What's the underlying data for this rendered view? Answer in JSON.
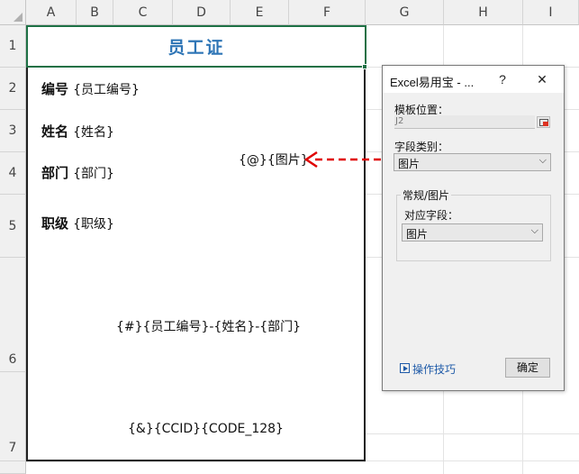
{
  "columns": [
    "A",
    "B",
    "C",
    "D",
    "E",
    "F",
    "G",
    "H",
    "I"
  ],
  "rows": [
    "1",
    "2",
    "3",
    "4",
    "5",
    "6",
    "7"
  ],
  "card": {
    "title": "员工证",
    "fields": [
      {
        "label": "编号",
        "value": "{员工编号}"
      },
      {
        "label": "姓名",
        "value": "{姓名}"
      },
      {
        "label": "部门",
        "value": "{部门}"
      },
      {
        "label": "职级",
        "value": "{职级}"
      }
    ],
    "photo_placeholder": "{@}{图片}",
    "qr_placeholder": "{#}{员工编号}-{姓名}-{部门}",
    "barcode_placeholder": "{&}{CCID}{CODE_128}"
  },
  "dialog": {
    "title": "Excel易用宝 - ...",
    "help": "?",
    "close": "✕",
    "template_label": "模板位置：",
    "template_value": "J2",
    "field_type_label": "字段类别：",
    "field_type_value": "图片",
    "group_label": "常规/图片",
    "mapped_field_label": "对应字段：",
    "mapped_field_value": "图片",
    "tips_label": "操作技巧",
    "ok_label": "确定"
  },
  "colors": {
    "title": "#2e75b6",
    "selection": "#1e7145",
    "arrow": "#e00000",
    "link": "#1e5aa8"
  }
}
